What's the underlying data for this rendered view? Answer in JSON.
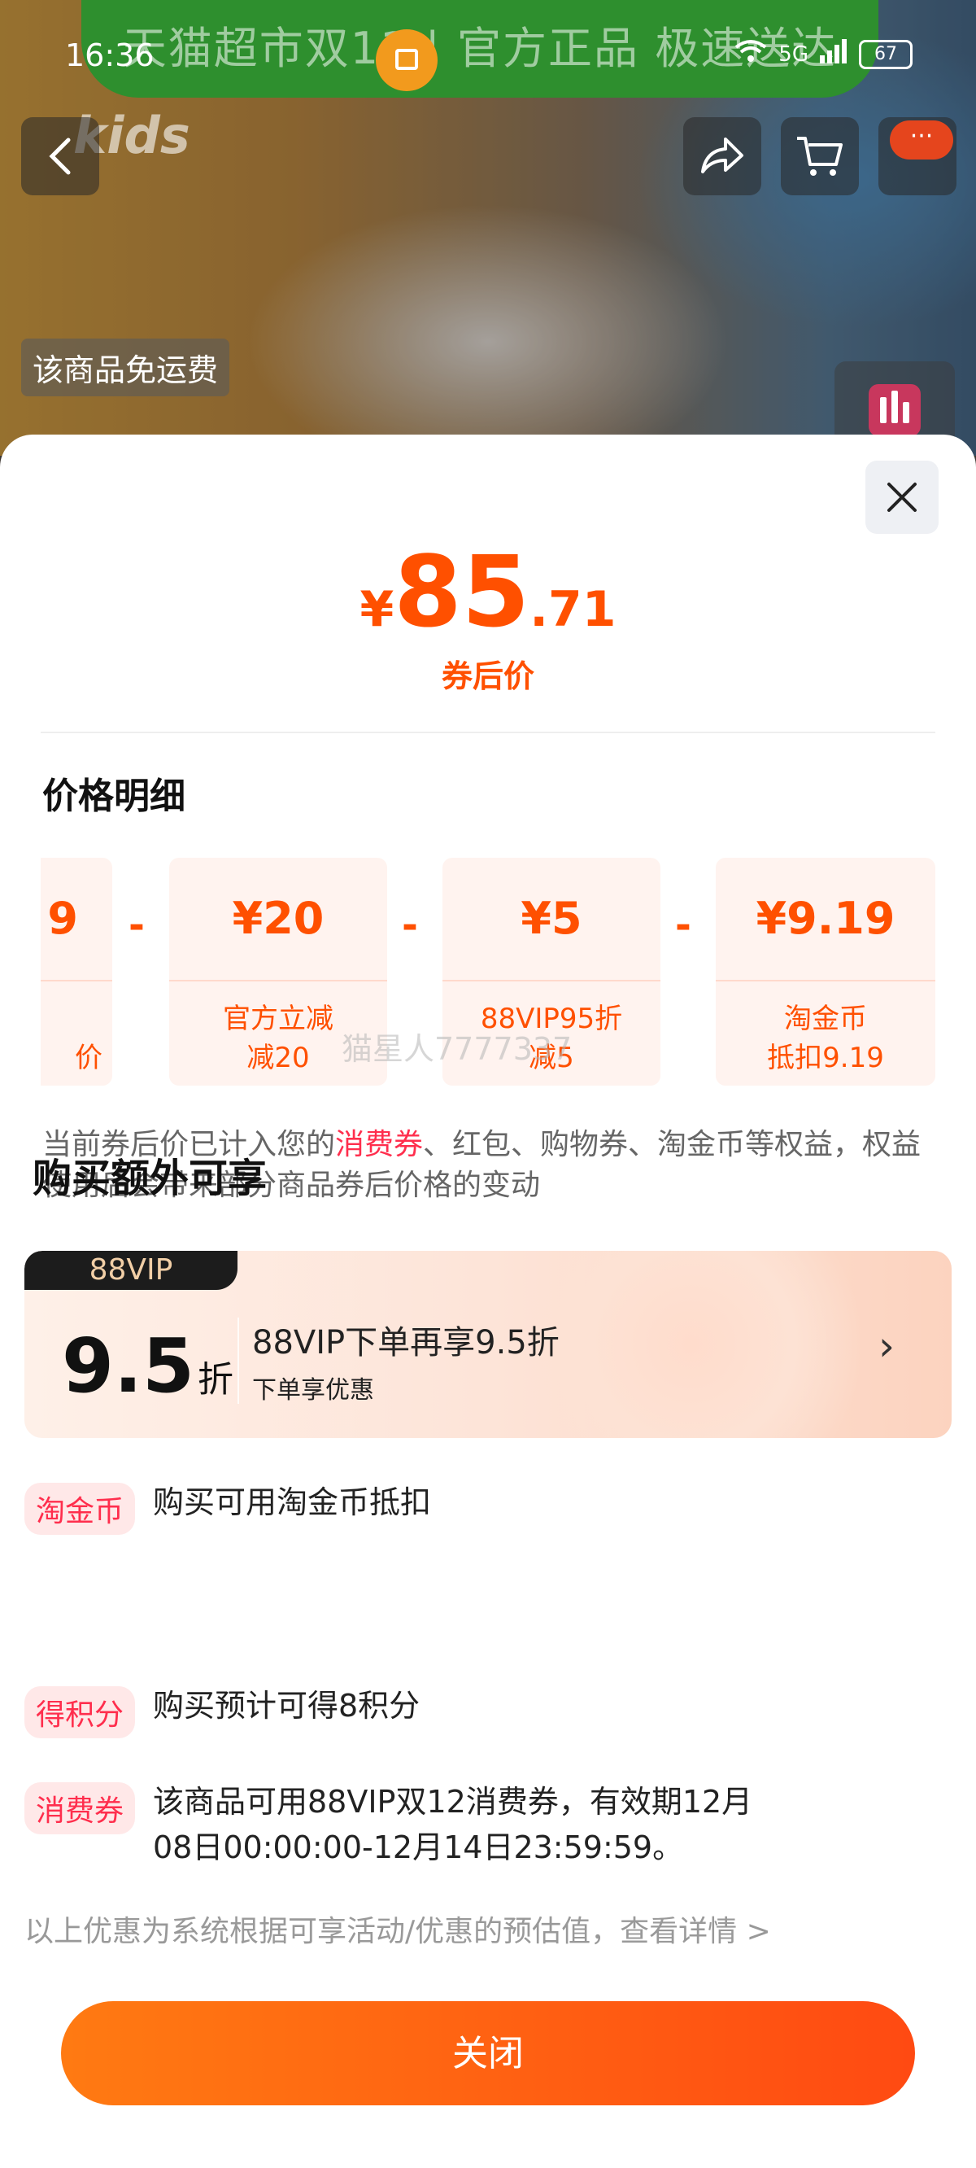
{
  "status": {
    "time": "16:36",
    "signal": "5G",
    "battery": "67"
  },
  "banner": {
    "text": "天猫超市双11 | 官方正品 极速送达"
  },
  "brand": {
    "logo": "kids"
  },
  "top_icons": [
    "back-icon",
    "share-icon",
    "cart-icon",
    "more-icon"
  ],
  "badges": {
    "free_shipping": "该商品免运费",
    "more_dots": "···"
  },
  "sheet": {
    "price": {
      "currency": "¥",
      "integer": "85",
      "decimal": ".71",
      "label": "券后价"
    },
    "detail_title": "价格明细",
    "breakdown": [
      {
        "amount": "9",
        "line1": "",
        "line2": "",
        "partial": true,
        "visible_suffix": "价"
      },
      {
        "amount": "¥20",
        "line1": "官方立减",
        "line2": "减20"
      },
      {
        "amount": "¥5",
        "line1": "88VIP95折",
        "line2": "减5"
      },
      {
        "amount": "¥9.19",
        "line1": "淘金币",
        "line2": "抵扣9.19"
      }
    ],
    "minus_sign": "-",
    "watermark": "猫星人7777337",
    "note": {
      "before": "当前券后价已计入您的",
      "highlight": "消费券",
      "after": "、红包、购物券、淘金币等权益，权益使用后会带来部分商品券后价格的变动"
    },
    "vip": {
      "tag": "88VIP",
      "discount": "9.5",
      "discount_unit": "折",
      "title": "88VIP下单再享9.5折",
      "subtitle": "下单享优惠",
      "arrow": "›"
    },
    "coin_row": {
      "tag": "淘金币",
      "text": "购买可用淘金币抵扣"
    },
    "extra_title": "购买额外可享",
    "points_row": {
      "tag": "得积分",
      "text": "购买预计可得8积分"
    },
    "voucher_row": {
      "tag": "消费券",
      "line1": "该商品可用88VIP双12消费券，有效期12月",
      "line2": "08日00:00:00-12月14日23:59:59。"
    },
    "footnote": "以上优惠为系统根据可享活动/优惠的预估值，查看详情 >",
    "close_button": "关闭"
  },
  "colors": {
    "accent": "#ff5000",
    "tag_red": "#ff2e4d",
    "banner_green": "#2e8f2e"
  }
}
